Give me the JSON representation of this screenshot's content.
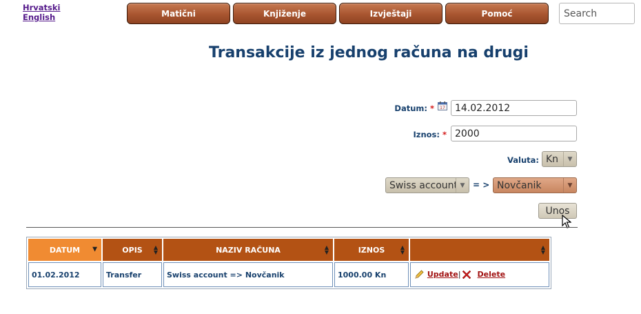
{
  "languages": [
    "Hrvatski",
    "English"
  ],
  "nav": [
    "Matični",
    "Knjiženje",
    "Izvještaji",
    "Pomoć"
  ],
  "search": {
    "placeholder": "Search"
  },
  "page_title": "Transakcije iz jednog računa na drugi",
  "form": {
    "datum_label": "Datum:",
    "datum_value": "14.02.2012",
    "iznos_label": "Iznos:",
    "iznos_value": "2000",
    "required_mark": "*",
    "valuta_label": "Valuta:",
    "valuta_value": "Kn",
    "from_account": "Swiss account",
    "arrow_text": "= >",
    "to_account": "Novčanik",
    "submit_label": "Unos"
  },
  "table": {
    "columns": [
      "DATUM",
      "OPIS",
      "NAZIV RAČUNA",
      "IZNOS",
      ""
    ],
    "rows": [
      {
        "datum": "01.02.2012",
        "opis": "Transfer",
        "naziv": "Swiss account => Novčanik",
        "iznos": "1000.00 Kn",
        "update_label": "Update",
        "delete_label": "Delete"
      }
    ]
  }
}
